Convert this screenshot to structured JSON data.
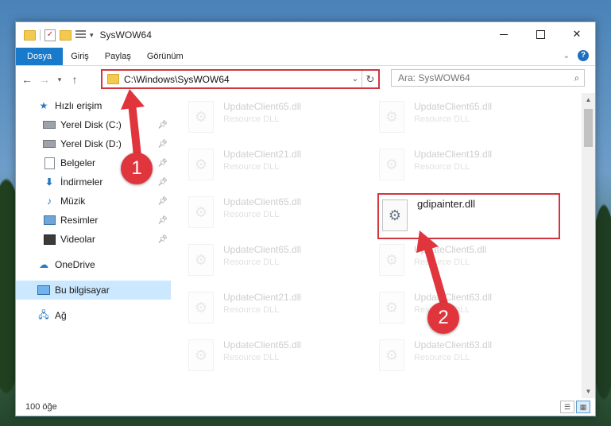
{
  "window": {
    "title": "SysWOW64",
    "qa_dropdown": "▾",
    "controls": {
      "minimize": "",
      "maximize": "",
      "close": "✕"
    }
  },
  "ribbon": {
    "tabs": [
      "Dosya",
      "Giriş",
      "Paylaş",
      "Görünüm"
    ],
    "collapse_icon": "chevron-down-icon",
    "help": "?"
  },
  "addressbar": {
    "path": "C:\\Windows\\SysWOW64",
    "search_placeholder": "Ara: SysWOW64"
  },
  "sidebar": {
    "items": [
      {
        "label": "Hızlı erişim",
        "icon": "star-icon",
        "pinned": false
      },
      {
        "label": "Yerel Disk (C:)",
        "icon": "drive-icon",
        "pinned": true
      },
      {
        "label": "Yerel Disk (D:)",
        "icon": "drive-icon",
        "pinned": true
      },
      {
        "label": "Belgeler",
        "icon": "documents-icon",
        "pinned": true
      },
      {
        "label": "İndirmeler",
        "icon": "download-icon",
        "pinned": true
      },
      {
        "label": "Müzik",
        "icon": "music-icon",
        "pinned": true
      },
      {
        "label": "Resimler",
        "icon": "pictures-icon",
        "pinned": true
      },
      {
        "label": "Videolar",
        "icon": "videos-icon",
        "pinned": true
      },
      {
        "label": "OneDrive",
        "icon": "cloud-icon",
        "pinned": false
      },
      {
        "label": "Bu bilgisayar",
        "icon": "computer-icon",
        "pinned": false,
        "selected": true
      },
      {
        "label": "Ağ",
        "icon": "network-icon",
        "pinned": false
      }
    ]
  },
  "files": [
    {
      "name": "UpdateClient65.dll",
      "type": "Resource DLL"
    },
    {
      "name": "UpdateClient65.dll",
      "type": "Resource DLL"
    },
    {
      "name": "UpdateClient21.dll",
      "type": "Resource DLL"
    },
    {
      "name": "UpdateClient19.dll",
      "type": "Resource DLL"
    },
    {
      "name": "UpdateClient65.dll",
      "type": "Resource DLL"
    },
    {
      "name": "gdipainter.dll",
      "type": "",
      "highlighted": true
    },
    {
      "name": "UpdateClient65.dll",
      "type": "Resource DLL"
    },
    {
      "name": "UpdateClient5.dll",
      "type": "Resource DLL"
    },
    {
      "name": "UpdateClient21.dll",
      "type": "Resource DLL"
    },
    {
      "name": "UpdateClient63.dll",
      "type": "Resource DLL"
    },
    {
      "name": "UpdateClient65.dll",
      "type": "Resource DLL"
    },
    {
      "name": "UpdateClient63.dll",
      "type": "Resource DLL"
    }
  ],
  "status": {
    "count": "100 öğe"
  },
  "annotations": {
    "step1": "1",
    "step2": "2"
  },
  "colors": {
    "accent": "#1979ca",
    "highlight": "#d2353d",
    "selected_nav": "#cce8ff"
  }
}
